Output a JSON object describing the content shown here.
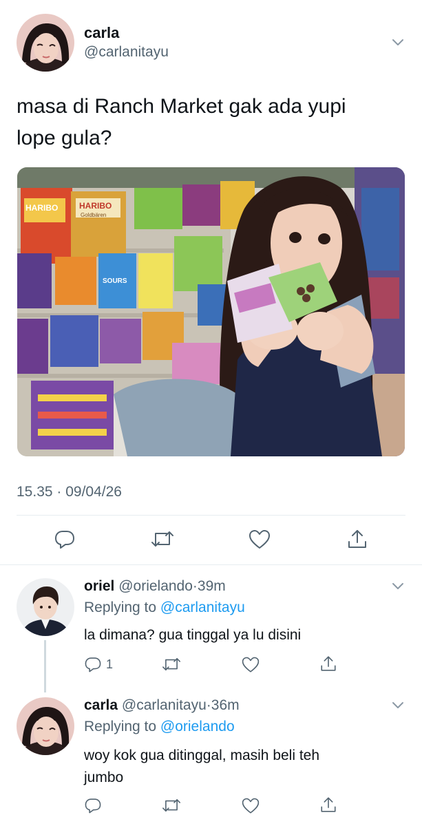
{
  "tweet": {
    "author_name": "carla",
    "author_handle": "@carlanitayu",
    "text_line1": "masa di Ranch Market gak ada yupi",
    "text_line2": "lope gula?",
    "timestamp": "15.35 · 09/04/26",
    "photo_labels": {
      "haribo_1": "HARIBO",
      "haribo_2": "HARIBO",
      "haribo_sub": "Goldbären",
      "sours": "SOURS"
    }
  },
  "replies": [
    {
      "name": "oriel",
      "handle": "@orielando",
      "sep": "·",
      "time": "39m",
      "replying_label": "Replying to",
      "replying_to": "@carlanitayu",
      "text": "la dimana? gua tinggal ya lu disini",
      "reply_count": "1"
    },
    {
      "name": "carla",
      "handle": "@carlanitayu",
      "sep": "·",
      "time": "36m",
      "replying_label": "Replying to",
      "replying_to": "@orielando",
      "text_line1": "woy kok gua ditinggal, masih beli teh",
      "text_line2": "jumbo",
      "reply_count": ""
    }
  ],
  "icons": [
    "chevron-down-icon",
    "reply-icon",
    "retweet-icon",
    "like-icon",
    "share-icon"
  ],
  "colors": {
    "text": "#0f1419",
    "secondary": "#536471",
    "link": "#1d9bf0",
    "divider": "#e6ecf0",
    "thread_line": "#cfd9de"
  }
}
